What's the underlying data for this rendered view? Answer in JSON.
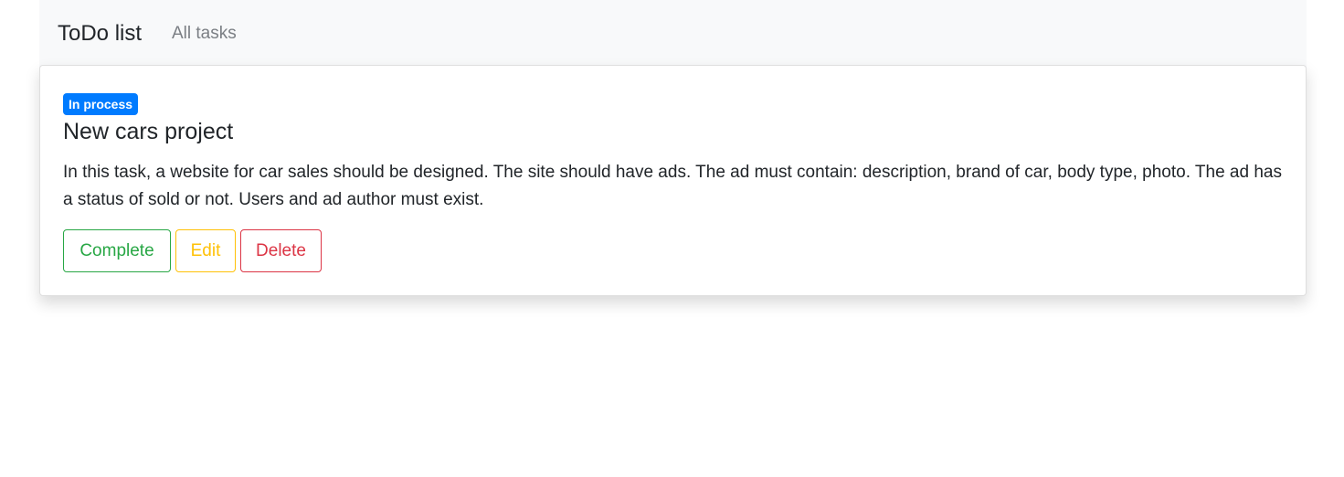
{
  "navbar": {
    "brand": "ToDo list",
    "links": [
      {
        "label": "All tasks"
      }
    ]
  },
  "task": {
    "status": "In process",
    "title": "New cars project",
    "description": "In this task, a website for car sales should be designed. The site should have ads. The ad must contain: description, brand of car, body type, photo. The ad has a status of sold or not. Users and ad author must exist.",
    "actions": {
      "complete_label": "Complete",
      "edit_label": "Edit",
      "delete_label": "Delete"
    }
  },
  "colors": {
    "badge": "#007bff",
    "complete": "#28a745",
    "edit": "#ffc107",
    "delete": "#dc3545",
    "navbar_bg": "#f8f9fa"
  }
}
